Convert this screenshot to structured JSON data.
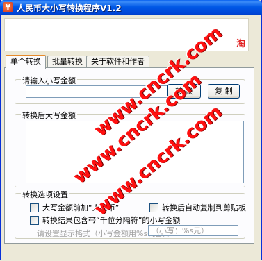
{
  "window": {
    "title": "人民币大小写转换程序V1.2"
  },
  "banner": {
    "logo": "淘"
  },
  "tabs": [
    {
      "label": "单个转换",
      "active": true
    },
    {
      "label": "批量转换",
      "active": false
    },
    {
      "label": "关于软件和作者",
      "active": false
    }
  ],
  "input_group": {
    "label": "请输入小写金额",
    "value": "",
    "convert_label": "转 换",
    "copy_label": "复 制"
  },
  "output_group": {
    "label": "转换后大写金额",
    "value": ""
  },
  "options": {
    "label": "转换选项设置",
    "add_rmb": "大写金额前加“人民币”",
    "auto_copy": "转换后自动复制到剪贴板",
    "include_thousands": "转换结果包含带“千位分隔符”的小写金额",
    "format_hint": "请设置显示格式（小写金额用%s代替）：",
    "format_value": "（小写：%s元）"
  },
  "watermark": {
    "text_1": "www.cncrk.com",
    "text_2": "www.cncrk.com",
    "text_3": "www.cncrk.com"
  },
  "colors": {
    "titlebar": "#0058e6",
    "watermark": "#ff1010",
    "tab_highlight": "#e68b2c"
  }
}
